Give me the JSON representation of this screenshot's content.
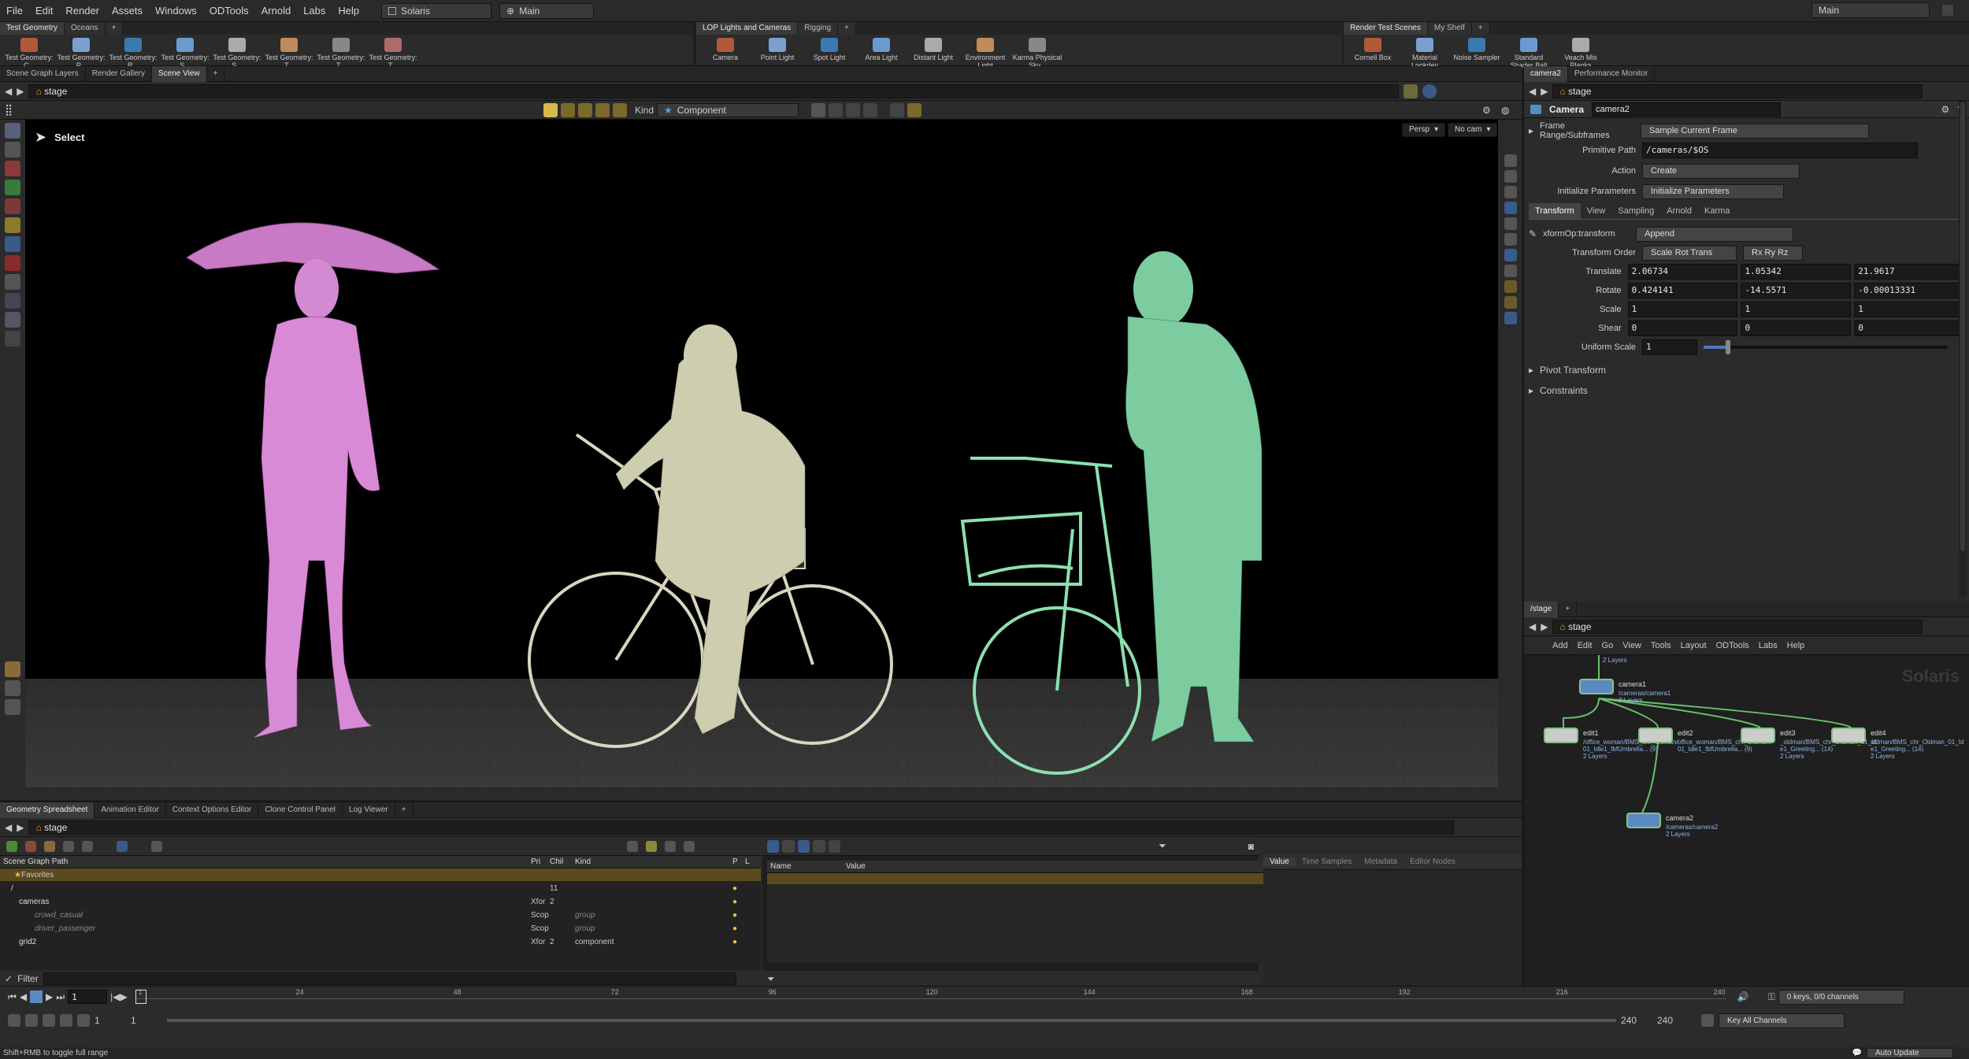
{
  "menubar": {
    "items": [
      "File",
      "Edit",
      "Render",
      "Assets",
      "Windows",
      "ODTools",
      "Arnold",
      "Labs",
      "Help"
    ],
    "desktop": "Solaris",
    "context": "Main",
    "right_context": "Main"
  },
  "shelf_left": {
    "tabs": [
      "Test Geometry",
      "Oceans"
    ],
    "tools": [
      "Test Geometry: C...",
      "Test Geometry: P...",
      "Test Geometry: R...",
      "Test Geometry: S...",
      "Test Geometry: S...",
      "Test Geometry: T...",
      "Test Geometry: T...",
      "Test Geometry: T..."
    ]
  },
  "shelf_mid": {
    "tabs": [
      "LOP Lights and Cameras",
      "Rigging"
    ],
    "tools": [
      "Camera",
      "Point Light",
      "Spot Light",
      "Area Light",
      "Distant Light",
      "Environment Light",
      "Karma Physical Sky..."
    ]
  },
  "shelf_right": {
    "tabs": [
      "Render Test Scenes",
      "My Shelf"
    ],
    "tools": [
      "Cornell Box",
      "Material Lookdev",
      "Noise Sampler",
      "Standard Shader Ball",
      "Veach Mis Planks"
    ]
  },
  "viewer": {
    "tabs": [
      "Scene Graph Layers",
      "Render Gallery",
      "Scene View"
    ],
    "path": "stage",
    "kind_label": "Kind",
    "kind_value": "Component",
    "select_label": "Select",
    "persp": "Persp",
    "cam": "No cam"
  },
  "params": {
    "tabs": [
      "camera2",
      "Performance Monitor"
    ],
    "path": "stage",
    "node_type": "Camera",
    "node_name": "camera2",
    "frame_range_label": "Frame Range/Subframes",
    "frame_range_value": "Sample Current Frame",
    "primitive_path_label": "Primitive Path",
    "primitive_path_value": "/cameras/$OS",
    "action_label": "Action",
    "action_value": "Create",
    "init_label": "Initialize Parameters",
    "init_value": "Initialize Parameters",
    "subtabs": [
      "Transform",
      "View",
      "Sampling",
      "Arnold",
      "Karma"
    ],
    "xform_label": "xformOp:transform",
    "xform_value": "Append",
    "order_label": "Transform Order",
    "order_value": "Scale Rot Trans",
    "order_value2": "Rx Ry Rz",
    "translate_label": "Translate",
    "translate": [
      "2.06734",
      "1.05342",
      "21.9617"
    ],
    "rotate_label": "Rotate",
    "rotate": [
      "0.424141",
      "-14.5571",
      "-0.00013331"
    ],
    "scale_label": "Scale",
    "scale": [
      "1",
      "1",
      "1"
    ],
    "shear_label": "Shear",
    "shear": [
      "0",
      "0",
      "0"
    ],
    "uniform_label": "Uniform Scale",
    "uniform_value": "1",
    "uniform_fraction": 0.1,
    "pivot_label": "Pivot Transform",
    "constraints_label": "Constraints"
  },
  "network": {
    "tab": "/stage",
    "path": "stage",
    "menu": [
      "Add",
      "Edit",
      "Go",
      "View",
      "Tools",
      "Layout",
      "ODTools",
      "Labs",
      "Help"
    ],
    "watermark": "Solaris",
    "top_sub": "2 Layers",
    "nodes": [
      {
        "name": "camera1",
        "sub1": "/cameras/camera1",
        "sub2": "2 Layers"
      },
      {
        "name": "edit1",
        "sub1": "/office_woman/BMS_chr_Woman/",
        "sub2": "01_Idle1_fbfUmbrella... (9)",
        "sub3": "2 Layers"
      },
      {
        "name": "edit2",
        "sub1": "office_woman/BMS_chr_Oldman/",
        "sub2": "01_Idle1_fbfUmbrella... (9)",
        "sub3": ""
      },
      {
        "name": "edit3",
        "sub1": "_oldman/BMS_chr_Oldman_01_Id",
        "sub2": "e1_Greeting... (14)",
        "sub3": "2 Layers"
      },
      {
        "name": "edit4",
        "sub1": "oldman/BMS_chr_Oldman_01_Id",
        "sub2": "e1_Greeting... (14)",
        "sub3": "2 Layers"
      },
      {
        "name": "camera2",
        "sub1": "/cameras/camera2",
        "sub2": "2 Layers"
      }
    ]
  },
  "bottom": {
    "tabs": [
      "Geometry Spreadsheet",
      "Animation Editor",
      "Context Options Editor",
      "Clone Control Panel",
      "Log Viewer"
    ],
    "path": "stage",
    "scene_cols": [
      "Scene Graph Path",
      "Pri",
      "Chil",
      "Kind",
      "P",
      "L"
    ],
    "favorites": "Favorites",
    "rows": [
      {
        "path": "/",
        "pri": "",
        "chil": "11",
        "kind": ""
      },
      {
        "path": "cameras",
        "pri": "Xfor",
        "chil": "2",
        "kind": ""
      },
      {
        "path": "crowd_casual",
        "pri": "Scop",
        "chil": "",
        "kind": "group"
      },
      {
        "path": "driver_passenger",
        "pri": "Scop",
        "chil": "",
        "kind": "group"
      },
      {
        "path": "grid2",
        "pri": "Xfor",
        "chil": "2",
        "kind": "component"
      }
    ],
    "filter": "Filter",
    "attr_cols": [
      "Name",
      "Value"
    ],
    "value_tabs": [
      "Value",
      "Time Samples",
      "Metadata",
      "Editor Nodes"
    ]
  },
  "timeline": {
    "frame": "1",
    "ticks": [
      "1",
      "24",
      "48",
      "72",
      "96",
      "120",
      "144",
      "168",
      "192",
      "216",
      "240"
    ],
    "start": "1",
    "start2": "1",
    "end": "240",
    "end2": "240",
    "keys": "0 keys, 0/0 channels",
    "key_all": "Key All Channels",
    "auto_update": "Auto Update"
  },
  "status": "Shift+RMB to toggle full range"
}
